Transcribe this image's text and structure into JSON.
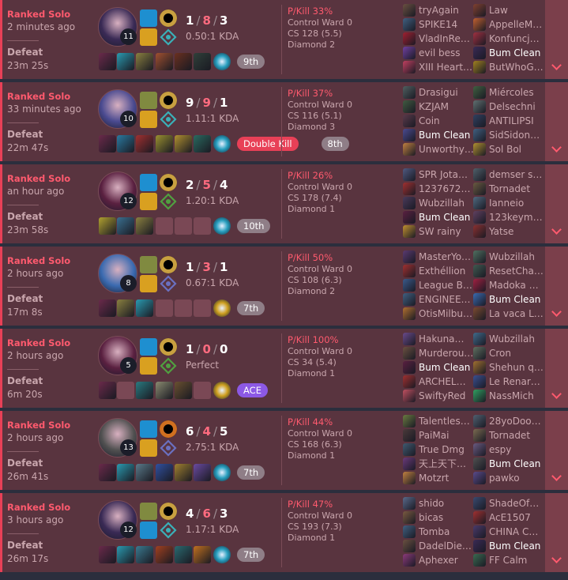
{
  "matches": [
    {
      "queue": "Ranked Solo",
      "ago": "2 minutes ago",
      "result": "Defeat",
      "duration": "23m 25s",
      "level": "11",
      "kills": "1",
      "deaths": "8",
      "assists": "3",
      "ratio": "0.50:1 KDA",
      "champion_icon": "evelynn-portrait",
      "champion_color": "#3a2a55",
      "spell_colors": [
        "#1e8fd0",
        "#d9a020"
      ],
      "rune_colors": [
        "#c8a040",
        "#3ab0b8"
      ],
      "items": [
        "#6a2a4a",
        "#2a9ab0",
        "#8a8040",
        "#a05030",
        "#6a3020",
        "#30403a"
      ],
      "ward_color": "#2aa0c0",
      "badges": [
        {
          "text": "9th",
          "kind": "place"
        }
      ],
      "pkill": "P/Kill 33%",
      "control_ward": "Control Ward 0",
      "cs": "CS 128 (5.5)",
      "rank": "Diamond 2",
      "team1": [
        {
          "name": "tryAgain",
          "color": "#6a5040"
        },
        {
          "name": "SPIKE14",
          "color": "#406080"
        },
        {
          "name": "VladInRe…",
          "color": "#a02030"
        },
        {
          "name": "evil bess",
          "color": "#7040a0"
        },
        {
          "name": "XIII Heart…",
          "color": "#c04060"
        }
      ],
      "team2": [
        {
          "name": "Law",
          "color": "#804030"
        },
        {
          "name": "AppelleM…",
          "color": "#c06030"
        },
        {
          "name": "Konfuncj…",
          "color": "#a03040"
        },
        {
          "name": "Bum Clean",
          "color": "#3a2a55",
          "me": true
        },
        {
          "name": "ButWhoG…",
          "color": "#a08020"
        }
      ]
    },
    {
      "queue": "Ranked Solo",
      "ago": "33 minutes ago",
      "result": "Defeat",
      "duration": "22m 47s",
      "level": "10",
      "kills": "9",
      "deaths": "9",
      "assists": "1",
      "ratio": "1.11:1 KDA",
      "champion_icon": "xayah-portrait",
      "champion_color": "#4a4a90",
      "spell_colors": [
        "#808a40",
        "#d9a020"
      ],
      "rune_colors": [
        "#c8a040",
        "#3ab0b8"
      ],
      "items": [
        "#6a2a4a",
        "#2a7aa0",
        "#a03030",
        "#9a9030",
        "#b09030",
        "#2a6a60"
      ],
      "ward_color": "#2aa0c0",
      "badges": [
        {
          "text": "Double Kill",
          "kind": "multi"
        },
        {
          "text": "8th",
          "kind": "place"
        }
      ],
      "pkill": "P/Kill 37%",
      "control_ward": "Control Ward 0",
      "cs": "CS 116 (5.1)",
      "rank": "Diamond 3",
      "team1": [
        {
          "name": "Drasigui",
          "color": "#506060"
        },
        {
          "name": "KZJAM",
          "color": "#405a40"
        },
        {
          "name": "Coin",
          "color": "#5a3a4a"
        },
        {
          "name": "Bum Clean",
          "color": "#4a4a90",
          "me": true
        },
        {
          "name": "Unworthy…",
          "color": "#c08040"
        }
      ],
      "team2": [
        {
          "name": "Miércoles",
          "color": "#406040"
        },
        {
          "name": "Delsechni",
          "color": "#607070"
        },
        {
          "name": "ANTILIPSI",
          "color": "#304060"
        },
        {
          "name": "SidSidon…",
          "color": "#406080"
        },
        {
          "name": "Sol Bol",
          "color": "#b09030"
        }
      ]
    },
    {
      "queue": "Ranked Solo",
      "ago": "an hour ago",
      "result": "Defeat",
      "duration": "23m 58s",
      "level": "12",
      "kills": "2",
      "deaths": "5",
      "assists": "4",
      "ratio": "1.20:1 KDA",
      "champion_icon": "vayne-portrait",
      "champion_color": "#5a2040",
      "spell_colors": [
        "#1e8fd0",
        "#d9a020"
      ],
      "rune_colors": [
        "#c8a040",
        "#50a040"
      ],
      "items": [
        "#b0a030",
        "#3a7090",
        "#8a8040",
        "",
        "",
        ""
      ],
      "ward_color": "#2aa0c0",
      "badges": [
        {
          "text": "10th",
          "kind": "place"
        }
      ],
      "pkill": "P/Kill 26%",
      "control_ward": "Control Ward 0",
      "cs": "CS 178 (7.4)",
      "rank": "Diamond 1",
      "team1": [
        {
          "name": "SPR Jota…",
          "color": "#505a80"
        },
        {
          "name": "1237672…",
          "color": "#a03030"
        },
        {
          "name": "Wubzillah",
          "color": "#4a3a5a"
        },
        {
          "name": "Bum Clean",
          "color": "#5a2040",
          "me": true
        },
        {
          "name": "SW rainy",
          "color": "#c09030"
        }
      ],
      "team2": [
        {
          "name": "demser s…",
          "color": "#50606a"
        },
        {
          "name": "Tornadet",
          "color": "#6a5a40"
        },
        {
          "name": "Ianneio",
          "color": "#506a80"
        },
        {
          "name": "123keym…",
          "color": "#604060"
        },
        {
          "name": "Yatse",
          "color": "#8a3030"
        }
      ]
    },
    {
      "queue": "Ranked Solo",
      "ago": "2 hours ago",
      "result": "Defeat",
      "duration": "17m 8s",
      "level": "8",
      "kills": "1",
      "deaths": "3",
      "assists": "1",
      "ratio": "0.67:1 KDA",
      "champion_icon": "jinx-portrait",
      "champion_color": "#3a6ab0",
      "spell_colors": [
        "#808a40",
        "#d9a020"
      ],
      "rune_colors": [
        "#c8a040",
        "#6a70c0"
      ],
      "items": [
        "#6a2a4a",
        "#8a8040",
        "#2a9ab0",
        "",
        "",
        ""
      ],
      "ward_color": "#d0a020",
      "badges": [
        {
          "text": "7th",
          "kind": "place"
        }
      ],
      "pkill": "P/Kill 50%",
      "control_ward": "Control Ward 0",
      "cs": "CS 108 (6.3)",
      "rank": "Diamond 2",
      "team1": [
        {
          "name": "MasterYo…",
          "color": "#5a3a70"
        },
        {
          "name": "Exthéllion",
          "color": "#a03030"
        },
        {
          "name": "League B…",
          "color": "#3a5a8a"
        },
        {
          "name": "ENGINEE…",
          "color": "#406080"
        },
        {
          "name": "OtisMilbu…",
          "color": "#b07030"
        }
      ],
      "team2": [
        {
          "name": "Wubzillah",
          "color": "#507060"
        },
        {
          "name": "ResetCha…",
          "color": "#405a50"
        },
        {
          "name": "Madoka …",
          "color": "#a02040"
        },
        {
          "name": "Bum Clean",
          "color": "#3a6ab0",
          "me": true
        },
        {
          "name": "La vaca L…",
          "color": "#7a4a30"
        }
      ]
    },
    {
      "queue": "Ranked Solo",
      "ago": "2 hours ago",
      "result": "Defeat",
      "duration": "6m 20s",
      "level": "5",
      "kills": "1",
      "deaths": "0",
      "assists": "0",
      "ratio": "Perfect",
      "champion_icon": "vayne-portrait",
      "champion_color": "#5a2040",
      "spell_colors": [
        "#1e8fd0",
        "#d9a020"
      ],
      "rune_colors": [
        "#c8a040",
        "#50a040"
      ],
      "items": [
        "#6a2a4a",
        "",
        "#2a7a80",
        "#8a8a70",
        "#6a5030",
        ""
      ],
      "ward_color": "#d0a020",
      "badges": [
        {
          "text": "ACE",
          "kind": "ace"
        }
      ],
      "pkill": "P/Kill 100%",
      "control_ward": "Control Ward 0",
      "cs": "CS 34 (5.4)",
      "rank": "Diamond 1",
      "team1": [
        {
          "name": "Hakuna…",
          "color": "#6a4a8a"
        },
        {
          "name": "Murderou…",
          "color": "#6a5040"
        },
        {
          "name": "Bum Clean",
          "color": "#5a2040",
          "me": true
        },
        {
          "name": "ARCHEL…",
          "color": "#a03030"
        },
        {
          "name": "SwiftyRed",
          "color": "#c05060"
        }
      ],
      "team2": [
        {
          "name": "Wubzillah",
          "color": "#406a8a"
        },
        {
          "name": "Cron",
          "color": "#607060"
        },
        {
          "name": "Shehun q…",
          "color": "#a07030"
        },
        {
          "name": "Le Renar…",
          "color": "#3a5090"
        },
        {
          "name": "NassMich",
          "color": "#30a060"
        }
      ]
    },
    {
      "queue": "Ranked Solo",
      "ago": "2 hours ago",
      "result": "Defeat",
      "duration": "26m 41s",
      "level": "13",
      "kills": "6",
      "deaths": "4",
      "assists": "5",
      "ratio": "2.75:1 KDA",
      "champion_icon": "jhin-portrait",
      "champion_color": "#505050",
      "spell_colors": [
        "#1e8fd0",
        "#d9a020"
      ],
      "rune_colors": [
        "#d07020",
        "#6a70c0"
      ],
      "items": [
        "#6a2a4a",
        "#2a9ab0",
        "#5a7a8a",
        "#3050a0",
        "#a08030",
        "#6a4aa0"
      ],
      "ward_color": "#2aa0c0",
      "badges": [
        {
          "text": "7th",
          "kind": "place"
        }
      ],
      "pkill": "P/Kill 44%",
      "control_ward": "Control Ward 0",
      "cs": "CS 168 (6.3)",
      "rank": "Diamond 1",
      "team1": [
        {
          "name": "Talentles…",
          "color": "#6a7a40"
        },
        {
          "name": "PaiMai",
          "color": "#4a3a3a"
        },
        {
          "name": "True Dmg",
          "color": "#405a70"
        },
        {
          "name": "天上天下…",
          "color": "#6a3a7a"
        },
        {
          "name": "Motzrt",
          "color": "#c08040"
        }
      ],
      "team2": [
        {
          "name": "28yoDoo…",
          "color": "#506070"
        },
        {
          "name": "Tornadet",
          "color": "#7a6a50"
        },
        {
          "name": "espy",
          "color": "#6a5a80"
        },
        {
          "name": "Bum Clean",
          "color": "#505050",
          "me": true
        },
        {
          "name": "pawko",
          "color": "#5a4a8a"
        }
      ]
    },
    {
      "queue": "Ranked Solo",
      "ago": "3 hours ago",
      "result": "Defeat",
      "duration": "26m 17s",
      "level": "12",
      "kills": "4",
      "deaths": "6",
      "assists": "3",
      "ratio": "1.17:1 KDA",
      "champion_icon": "evelynn-portrait",
      "champion_color": "#3a2a55",
      "spell_colors": [
        "#808a40",
        "#1e8fd0"
      ],
      "rune_colors": [
        "#c8a040",
        "#3ab0b8"
      ],
      "items": [
        "#6a2a4a",
        "#2a9ab0",
        "#3a7a90",
        "#a04020",
        "#2a6a70",
        "#c07020"
      ],
      "ward_color": "#2aa0c0",
      "badges": [
        {
          "text": "7th",
          "kind": "place"
        }
      ],
      "pkill": "P/Kill 47%",
      "control_ward": "Control Ward 0",
      "cs": "CS 193 (7.3)",
      "rank": "Diamond 1",
      "team1": [
        {
          "name": "shido",
          "color": "#5a6a8a"
        },
        {
          "name": "bicas",
          "color": "#7a5a40"
        },
        {
          "name": "Tomba",
          "color": "#406080"
        },
        {
          "name": "DadelDie…",
          "color": "#6a5040"
        },
        {
          "name": "Aphexer",
          "color": "#8a3a7a"
        }
      ],
      "team2": [
        {
          "name": "ShadeOf…",
          "color": "#3a4a70"
        },
        {
          "name": "AcE1507",
          "color": "#a03030"
        },
        {
          "name": "CHINA C…",
          "color": "#4a3a6a"
        },
        {
          "name": "Bum Clean",
          "color": "#3a2a55",
          "me": true
        },
        {
          "name": "FF Calm",
          "color": "#3a6a50"
        }
      ]
    }
  ]
}
